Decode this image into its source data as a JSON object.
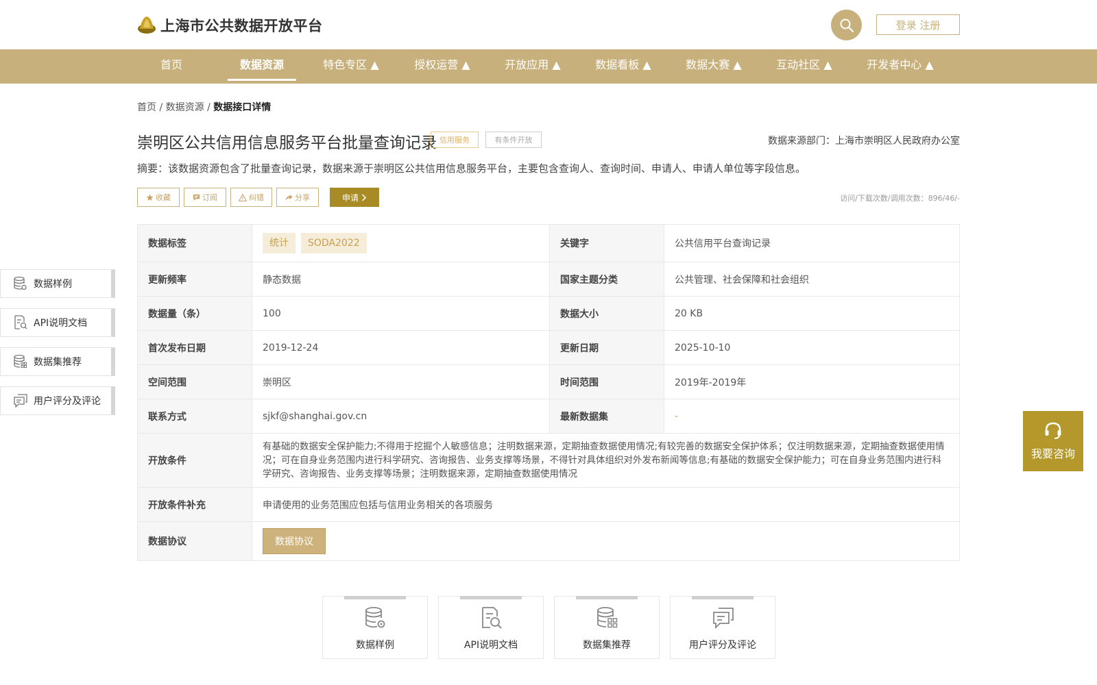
{
  "header": {
    "site_title": "上海市公共数据开放平台",
    "login_label": "登录 注册",
    "icons": {
      "logo": "logo-icon",
      "search": "search-icon"
    }
  },
  "nav": {
    "items": [
      {
        "label": "首页"
      },
      {
        "label": "数据资源",
        "active": true
      },
      {
        "label": "特色专区 ▲"
      },
      {
        "label": "授权运营 ▲"
      },
      {
        "label": "开放应用 ▲"
      },
      {
        "label": "数据看板 ▲"
      },
      {
        "label": "数据大赛 ▲"
      },
      {
        "label": "互动社区 ▲"
      },
      {
        "label": "开发者中心 ▲"
      }
    ]
  },
  "breadcrumb": {
    "home": "首页",
    "sep1": " / ",
    "resource": "数据资源",
    "sep2": " / ",
    "current": "数据接口详情"
  },
  "detail": {
    "title": "崇明区公共信用信息服务平台批量查询记录",
    "tag_category": "信用服务",
    "tag_open": "有条件开放",
    "source_dept": "数据来源部门：上海市崇明区人民政府办公室",
    "summary": "摘要：该数据资源包含了批量查询记录，数据来源于崇明区公共信用信息服务平台，主要包含查询人、查询时间、申请人、申请人单位等字段信息。",
    "actions": {
      "favorite": "收藏",
      "subscribe": "订阅",
      "correct": "纠错",
      "share": "分享",
      "apply": "申请"
    },
    "stats": "访问/下载次数/调用次数：896/46/-"
  },
  "table": {
    "labels": {
      "tags": "数据标签",
      "keyword": "关键字",
      "freq": "更新频率",
      "theme": "国家主题分类",
      "count": "数据量（条）",
      "size": "数据大小",
      "first_date": "首次发布日期",
      "update_date": "更新日期",
      "space": "空间范围",
      "time": "时间范围",
      "contact": "联系方式",
      "latest": "最新数据集",
      "cond": "开放条件",
      "cond_extra": "开放条件补充",
      "agreement": "数据协议"
    },
    "values": {
      "tag1": "统计",
      "tag2": "SODA2022",
      "keyword": "公共信用平台查询记录",
      "freq": "静态数据",
      "theme": "公共管理、社会保障和社会组织",
      "count": "100",
      "size": "20 KB",
      "first_date": "2019-12-24",
      "update_date": "2025-10-10",
      "space": "崇明区",
      "time": "2019年-2019年",
      "contact": "sjkf@shanghai.gov.cn",
      "latest": "-",
      "cond": "有基础的数据安全保护能力;不得用于挖掘个人敏感信息；注明数据来源，定期抽查数据使用情况;有较完善的数据安全保护体系；仅注明数据来源，定期抽查数据使用情况；可在自身业务范围内进行科学研究、咨询报告、业务支撑等场景，不得针对具体组织对外发布新闻等信息;有基础的数据安全保护能力；可在自身业务范围内进行科学研究、咨询报告、业务支撑等场景；注明数据来源，定期抽查数据使用情况",
      "cond_extra": "申请使用的业务范围应包括与信用业务相关的各项服务",
      "agreement_btn": "数据协议"
    }
  },
  "sidebar": {
    "items": [
      {
        "label": "数据样例",
        "icon": "database-gear-icon"
      },
      {
        "label": "API说明文档",
        "icon": "document-search-icon"
      },
      {
        "label": "数据集推荐",
        "icon": "database-grid-icon"
      },
      {
        "label": "用户评分及评论",
        "icon": "comment-icon"
      }
    ]
  },
  "consult": {
    "label": "我要咨询",
    "icon": "headset-icon"
  },
  "cards": [
    {
      "label": "数据样例"
    },
    {
      "label": "API说明文档"
    },
    {
      "label": "数据集推荐"
    },
    {
      "label": "用户评分及评论"
    }
  ],
  "colors": {
    "gold": "#c8b07c",
    "dark_gold": "#a88b24",
    "consult": "#b4982c"
  }
}
